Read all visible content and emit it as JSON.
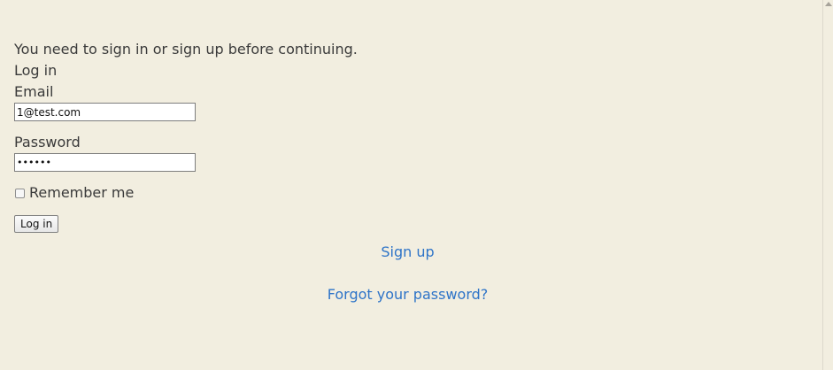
{
  "notice": "You need to sign in or sign up before continuing.",
  "heading": "Log in",
  "form": {
    "email_label": "Email",
    "email_value": "1@test.com",
    "password_label": "Password",
    "password_value": "••••••",
    "remember_label": "Remember me",
    "remember_checked": false,
    "submit_label": "Log in"
  },
  "links": {
    "sign_up": "Sign up",
    "forgot_password": "Forgot your password?"
  },
  "colors": {
    "background": "#f2eee0",
    "link": "#2e74c8",
    "text": "#3a3a3a"
  }
}
